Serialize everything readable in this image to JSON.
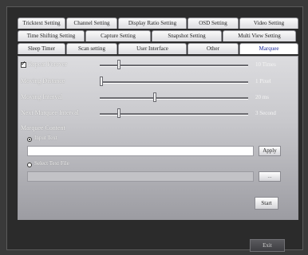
{
  "tabs": {
    "row1": [
      "Tricktext Setting",
      "Channel Setting",
      "Display Ratio Setting",
      "OSD Setting",
      "Video Setting"
    ],
    "row2": [
      "Time Shifting Setting",
      "Capture Setting",
      "Snapshot Setting",
      "Multi View Setting"
    ],
    "row3": [
      "Sleep Timer",
      "Scan setting",
      "User Interface",
      "Other",
      "Marquee"
    ],
    "active": "Marquee"
  },
  "marquee": {
    "repeat_forever_label": "Repeat Forever",
    "repeat_forever_checked": true,
    "repeat_value": "10 Times",
    "repeat_level": 0.12,
    "moving_distance_label": "Moving Distance",
    "moving_distance_value": "1 Pixel",
    "moving_distance_level": 0.0,
    "moving_interval_label": "Moving Interval",
    "moving_interval_value": "20 ms",
    "moving_interval_level": 0.37,
    "next_interval_label": "Next Marquee Interval",
    "next_interval_value": "3 Second",
    "next_interval_level": 0.12,
    "content_label": "Marquee Content",
    "input_text_label": "Input Text",
    "input_text_selected": true,
    "input_text_value": "",
    "apply_label": "Apply",
    "select_file_label": "Select Text File",
    "select_file_selected": false,
    "file_path_value": "",
    "browse_label": "...",
    "start_label": "Start"
  },
  "footer": {
    "exit_label": "Exit"
  }
}
